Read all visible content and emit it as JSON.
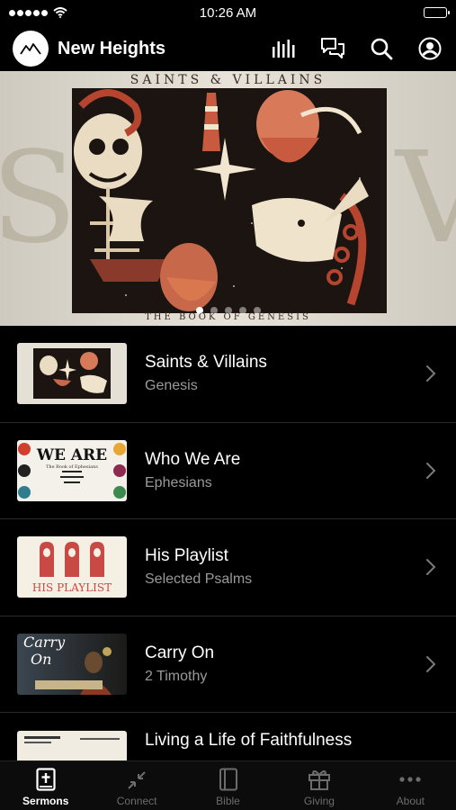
{
  "status_bar": {
    "time": "10:26 AM"
  },
  "header": {
    "title": "New Heights"
  },
  "hero": {
    "top_text": "SAINTS & VILLAINS",
    "bottom_text": "THE BOOK OF GENESIS",
    "active_slide": 1,
    "slide_count": 5
  },
  "sermons": [
    {
      "title": "Saints & Villains",
      "subtitle": "Genesis"
    },
    {
      "title": "Who We Are",
      "subtitle": "Ephesians",
      "thumb_text": "WE ARE",
      "thumb_caption": "The Book of Ephesians"
    },
    {
      "title": "His Playlist",
      "subtitle": "Selected Psalms",
      "thumb_text": "HIS PLAYLIST"
    },
    {
      "title": "Carry On",
      "subtitle": "2 Timothy",
      "thumb_text_1": "Carry",
      "thumb_text_2": "On"
    },
    {
      "title": "Living a Life of Faithfulness",
      "subtitle": ""
    }
  ],
  "tabs": [
    {
      "label": "Sermons",
      "icon": "bible-plus-icon"
    },
    {
      "label": "Connect",
      "icon": "connect-arrows-icon"
    },
    {
      "label": "Bible",
      "icon": "book-icon"
    },
    {
      "label": "Giving",
      "icon": "gift-icon"
    },
    {
      "label": "About",
      "icon": "more-dots-icon"
    }
  ],
  "colors": {
    "background": "#000000",
    "accent_red": "#b5452f",
    "subtitle": "#9a9a9a"
  }
}
